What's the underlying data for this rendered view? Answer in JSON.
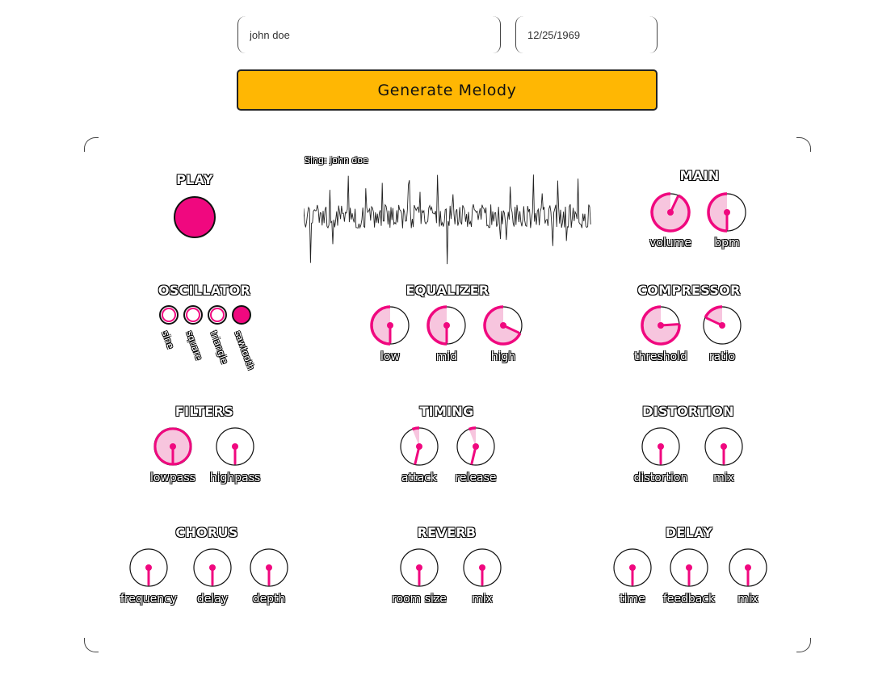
{
  "inputs": {
    "name_value": "john doe",
    "date_value": "12/25/1969"
  },
  "generate_label": "Generate Melody",
  "play": {
    "title": "PLAY"
  },
  "waveform": {
    "title": "Sing: john doe"
  },
  "sections": {
    "main": {
      "title": "MAIN",
      "knobs": [
        {
          "label": "volume",
          "value": 0.93
        },
        {
          "label": "bpm",
          "value": 0.5
        }
      ]
    },
    "oscillator": {
      "title": "OSCILLATOR",
      "options": [
        "sine",
        "square",
        "triangle",
        "sawtooth"
      ],
      "selected": "sawtooth"
    },
    "equalizer": {
      "title": "EQUALIZER",
      "knobs": [
        {
          "label": "low",
          "value": 0.5
        },
        {
          "label": "mid",
          "value": 0.5
        },
        {
          "label": "high",
          "value": 0.68
        }
      ]
    },
    "compressor": {
      "title": "COMPRESSOR",
      "knobs": [
        {
          "label": "threshold",
          "value": 0.76
        },
        {
          "label": "ratio",
          "value": 0.18
        }
      ]
    },
    "filters": {
      "title": "FILTERS",
      "knobs": [
        {
          "label": "lowpass",
          "value": 1.0
        },
        {
          "label": "highpass",
          "value": 0.0
        }
      ]
    },
    "timing": {
      "title": "TIMING",
      "knobs": [
        {
          "label": "attack",
          "value": 0.06
        },
        {
          "label": "release",
          "value": 0.06
        }
      ]
    },
    "distortion": {
      "title": "DISTORTION",
      "knobs": [
        {
          "label": "distortion",
          "value": 0.0
        },
        {
          "label": "mix",
          "value": 0.0
        }
      ]
    },
    "chorus": {
      "title": "CHORUS",
      "knobs": [
        {
          "label": "frequency",
          "value": 0.0
        },
        {
          "label": "delay",
          "value": 0.0
        },
        {
          "label": "depth",
          "value": 0.0
        }
      ]
    },
    "reverb": {
      "title": "REVERB",
      "knobs": [
        {
          "label": "room size",
          "value": 0.0
        },
        {
          "label": "mix",
          "value": 0.0
        }
      ]
    },
    "delay": {
      "title": "DELAY",
      "knobs": [
        {
          "label": "time",
          "value": 0.0
        },
        {
          "label": "feedback",
          "value": 0.0
        },
        {
          "label": "mix",
          "value": 0.0
        }
      ]
    }
  },
  "colors": {
    "accent": "#f0087f",
    "fill": "#f7c5de",
    "button": "#ffb703"
  }
}
